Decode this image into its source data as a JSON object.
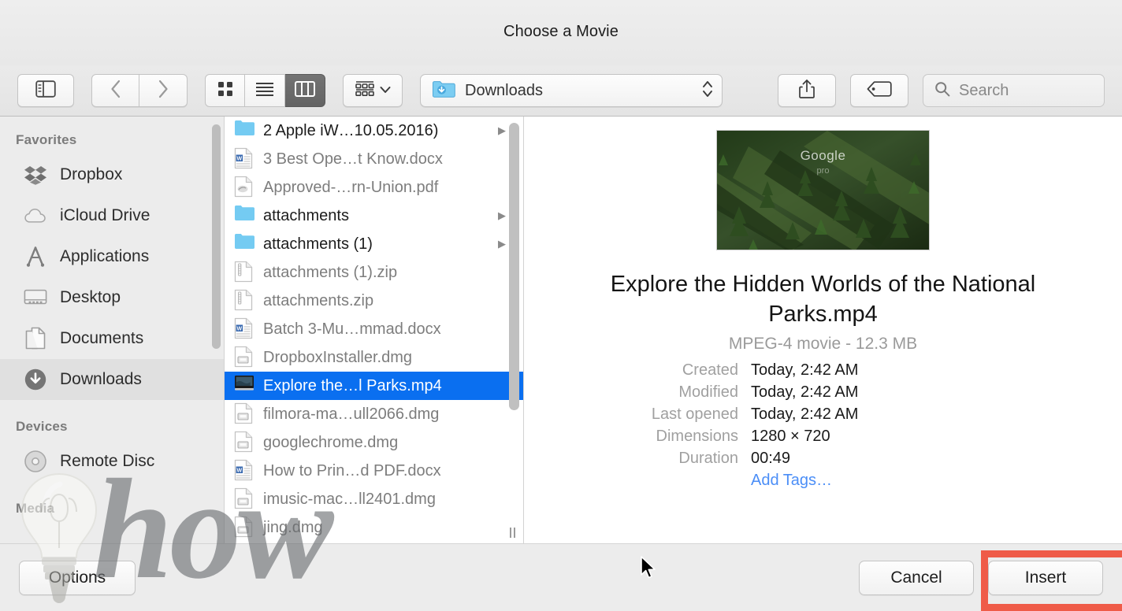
{
  "window": {
    "title": "Choose a Movie"
  },
  "toolbar": {
    "sidebar_toggle_icon": "sidebar-icon",
    "back_label": "‹",
    "forward_label": "›",
    "view_modes": [
      {
        "name": "icon-view",
        "icon": "grid-icon",
        "active": false
      },
      {
        "name": "list-view",
        "icon": "list-icon",
        "active": false
      },
      {
        "name": "column-view",
        "icon": "columns-icon",
        "active": true
      }
    ],
    "arrange_icon": "arrange-icon",
    "arrange_chevron": "˅",
    "path_popup": {
      "icon": "downloads-folder-icon",
      "label": "Downloads",
      "stepper_icon": "updown-chevrons-icon"
    },
    "share_icon": "share-icon",
    "tag_icon": "tag-icon",
    "search": {
      "icon": "search-icon",
      "placeholder": "Search",
      "value": ""
    }
  },
  "sidebar": {
    "sections": [
      {
        "heading": "Favorites",
        "items": [
          {
            "label": "Dropbox",
            "icon": "dropbox-icon",
            "selected": false
          },
          {
            "label": "iCloud Drive",
            "icon": "cloud-icon",
            "selected": false
          },
          {
            "label": "Applications",
            "icon": "applications-icon",
            "selected": false
          },
          {
            "label": "Desktop",
            "icon": "desktop-icon",
            "selected": false
          },
          {
            "label": "Documents",
            "icon": "documents-icon",
            "selected": false
          },
          {
            "label": "Downloads",
            "icon": "downloads-icon",
            "selected": true
          }
        ]
      },
      {
        "heading": "Devices",
        "items": [
          {
            "label": "Remote Disc",
            "icon": "disc-icon",
            "selected": false
          }
        ]
      },
      {
        "heading": "Media",
        "items": []
      }
    ]
  },
  "file_list": {
    "rows": [
      {
        "name": "2 Apple iW…10.05.2016)",
        "icon": "folder-icon",
        "kind": "folder",
        "enabled": true,
        "selected": false,
        "has_chevron": true
      },
      {
        "name": "3 Best Ope…t Know.docx",
        "icon": "word-doc-icon",
        "kind": "docx",
        "enabled": false,
        "selected": false,
        "has_chevron": false
      },
      {
        "name": "Approved-…rn-Union.pdf",
        "icon": "pdf-doc-icon",
        "kind": "pdf",
        "enabled": false,
        "selected": false,
        "has_chevron": false
      },
      {
        "name": "attachments",
        "icon": "folder-icon",
        "kind": "folder",
        "enabled": true,
        "selected": false,
        "has_chevron": true
      },
      {
        "name": "attachments (1)",
        "icon": "folder-icon",
        "kind": "folder",
        "enabled": true,
        "selected": false,
        "has_chevron": true
      },
      {
        "name": "attachments (1).zip",
        "icon": "zip-doc-icon",
        "kind": "zip",
        "enabled": false,
        "selected": false,
        "has_chevron": false
      },
      {
        "name": "attachments.zip",
        "icon": "zip-doc-icon",
        "kind": "zip",
        "enabled": false,
        "selected": false,
        "has_chevron": false
      },
      {
        "name": "Batch 3-Mu…mmad.docx",
        "icon": "word-doc-icon",
        "kind": "docx",
        "enabled": false,
        "selected": false,
        "has_chevron": false
      },
      {
        "name": "DropboxInstaller.dmg",
        "icon": "dmg-doc-icon",
        "kind": "dmg",
        "enabled": false,
        "selected": false,
        "has_chevron": false
      },
      {
        "name": "Explore the…l Parks.mp4",
        "icon": "movie-icon",
        "kind": "mp4",
        "enabled": true,
        "selected": true,
        "has_chevron": false
      },
      {
        "name": "filmora-ma…ull2066.dmg",
        "icon": "dmg-doc-icon",
        "kind": "dmg",
        "enabled": false,
        "selected": false,
        "has_chevron": false
      },
      {
        "name": "googlechrome.dmg",
        "icon": "dmg-doc-icon",
        "kind": "dmg",
        "enabled": false,
        "selected": false,
        "has_chevron": false
      },
      {
        "name": "How to Prin…d PDF.docx",
        "icon": "word-doc-icon",
        "kind": "docx",
        "enabled": false,
        "selected": false,
        "has_chevron": false
      },
      {
        "name": "imusic-mac…ll2401.dmg",
        "icon": "dmg-doc-icon",
        "kind": "dmg",
        "enabled": false,
        "selected": false,
        "has_chevron": false
      },
      {
        "name": "jing.dmg",
        "icon": "dmg-doc-icon",
        "kind": "dmg",
        "enabled": false,
        "selected": false,
        "has_chevron": false
      }
    ]
  },
  "preview": {
    "thumbnail": {
      "overlay_text": "Google",
      "overlay_subtext": "pro"
    },
    "filename": "Explore the Hidden Worlds of the National Parks.mp4",
    "kind_and_size": "MPEG-4 movie - 12.3 MB",
    "attributes": [
      {
        "key": "Created",
        "value": "Today, 2:42 AM",
        "link": false
      },
      {
        "key": "Modified",
        "value": "Today, 2:42 AM",
        "link": false
      },
      {
        "key": "Last opened",
        "value": "Today, 2:42 AM",
        "link": false
      },
      {
        "key": "Dimensions",
        "value": "1280 × 720",
        "link": false
      },
      {
        "key": "Duration",
        "value": "00:49",
        "link": false
      },
      {
        "key": "",
        "value": "Add Tags…",
        "link": true
      }
    ]
  },
  "bottom_bar": {
    "options_label": "Options",
    "cancel_label": "Cancel",
    "insert_label": "Insert"
  },
  "annotation": {
    "highlight_color": "#ef5b48",
    "target": "insert-button"
  },
  "watermark": {
    "text": "how",
    "graphic": "lightbulb-icon"
  },
  "colors": {
    "selection_blue": "#0a6ff0",
    "link_blue": "#4b8ef7",
    "folder_blue": "#6ec8f0",
    "window_chrome": "#ececec",
    "highlight_red": "#ef5b48"
  }
}
